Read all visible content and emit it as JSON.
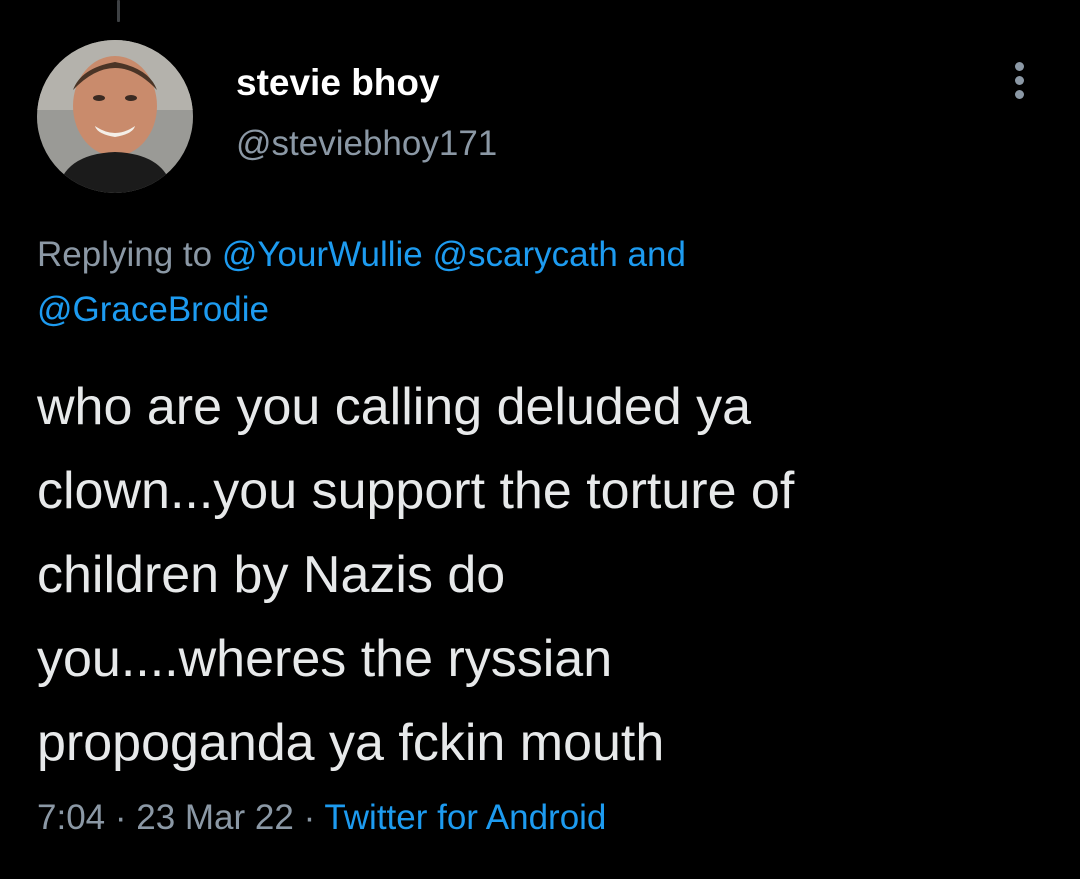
{
  "tweet": {
    "author": {
      "display_name": "stevie bhoy",
      "handle": "@steviebhoy171"
    },
    "reply_context": {
      "prefix": "Replying to",
      "mentions": [
        "@YourWullie",
        "@scarycath",
        "@GraceBrodie"
      ],
      "conjunction": "and"
    },
    "text_lines": [
      "who are you calling deluded ya",
      "clown...you support the torture of",
      "children by Nazis do",
      "you....wheres the ryssian",
      "propoganda ya fckin mouth"
    ],
    "meta": {
      "time": "7:04",
      "separator": "·",
      "date": "23 Mar 22",
      "source": "Twitter for Android"
    }
  },
  "icons": {
    "more": "more-vertical-icon"
  },
  "colors": {
    "background": "#000000",
    "primary_text": "#e7e9ea",
    "secondary_text": "#8b98a5",
    "accent": "#1d9bf0"
  }
}
